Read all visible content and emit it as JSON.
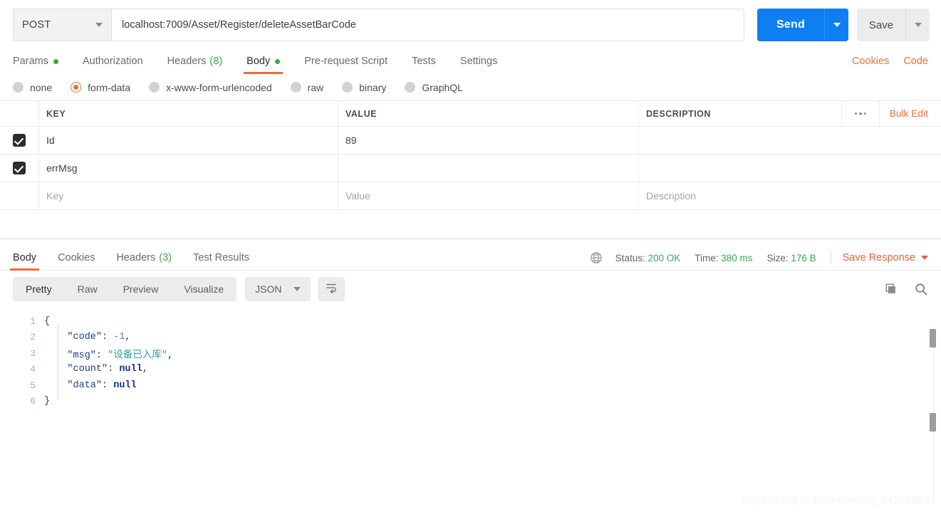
{
  "request": {
    "method": "POST",
    "url": "localhost:7009/Asset/Register/deleteAssetBarCode",
    "send_label": "Send",
    "save_label": "Save",
    "tabs": [
      {
        "label": "Params",
        "dot": true
      },
      {
        "label": "Authorization",
        "dot": false
      },
      {
        "label": "Headers",
        "count": "(8)"
      },
      {
        "label": "Body",
        "dot": true,
        "active": true
      },
      {
        "label": "Pre-request Script"
      },
      {
        "label": "Tests"
      },
      {
        "label": "Settings"
      }
    ],
    "links": {
      "cookies": "Cookies",
      "code": "Code"
    },
    "body_types": [
      {
        "label": "none",
        "selected": false
      },
      {
        "label": "form-data",
        "selected": true
      },
      {
        "label": "x-www-form-urlencoded",
        "selected": false
      },
      {
        "label": "raw",
        "selected": false
      },
      {
        "label": "binary",
        "selected": false
      },
      {
        "label": "GraphQL",
        "selected": false
      }
    ],
    "table": {
      "headers": {
        "key": "KEY",
        "value": "VALUE",
        "description": "DESCRIPTION"
      },
      "bulk_edit": "Bulk Edit",
      "rows": [
        {
          "checked": true,
          "key": "Id",
          "value": "89",
          "description": ""
        },
        {
          "checked": true,
          "key": "errMsg",
          "value": "",
          "description": ""
        }
      ],
      "placeholder_row": {
        "key": "Key",
        "value": "Value",
        "description": "Description"
      }
    }
  },
  "response": {
    "tabs": [
      {
        "label": "Body",
        "active": true
      },
      {
        "label": "Cookies"
      },
      {
        "label": "Headers",
        "count": "(3)"
      },
      {
        "label": "Test Results"
      }
    ],
    "status_label": "Status:",
    "status_value": "200 OK",
    "time_label": "Time:",
    "time_value": "380 ms",
    "size_label": "Size:",
    "size_value": "176 B",
    "save_response": "Save Response",
    "viewer": {
      "modes": [
        {
          "label": "Pretty",
          "active": true
        },
        {
          "label": "Raw"
        },
        {
          "label": "Preview"
        },
        {
          "label": "Visualize"
        }
      ],
      "format": "JSON"
    },
    "code_lines": [
      {
        "n": "1",
        "segments": [
          {
            "t": "{",
            "c": "j-punc"
          }
        ]
      },
      {
        "n": "2",
        "segments": [
          {
            "t": "    \"code\"",
            "c": "j-key"
          },
          {
            "t": ": ",
            "c": "j-punc"
          },
          {
            "t": "-1",
            "c": "j-num"
          },
          {
            "t": ",",
            "c": "j-punc"
          }
        ]
      },
      {
        "n": "3",
        "segments": [
          {
            "t": "    \"msg\"",
            "c": "j-key"
          },
          {
            "t": ": ",
            "c": "j-punc"
          },
          {
            "t": "\"设备已入库\"",
            "c": "j-str"
          },
          {
            "t": ",",
            "c": "j-punc"
          }
        ]
      },
      {
        "n": "4",
        "segments": [
          {
            "t": "    \"count\"",
            "c": "j-key"
          },
          {
            "t": ": ",
            "c": "j-punc"
          },
          {
            "t": "null",
            "c": "j-null"
          },
          {
            "t": ",",
            "c": "j-punc"
          }
        ]
      },
      {
        "n": "5",
        "segments": [
          {
            "t": "    \"data\"",
            "c": "j-key"
          },
          {
            "t": ": ",
            "c": "j-punc"
          },
          {
            "t": "null",
            "c": "j-null"
          }
        ]
      },
      {
        "n": "6",
        "segments": [
          {
            "t": "}",
            "c": "j-punc"
          }
        ]
      }
    ]
  },
  "watermark": "https://blog.csdn.net/weixin_44226883",
  "colors": {
    "accent_orange": "#e8703a",
    "send_blue": "#0d7ff3",
    "status_green": "#40a357"
  }
}
